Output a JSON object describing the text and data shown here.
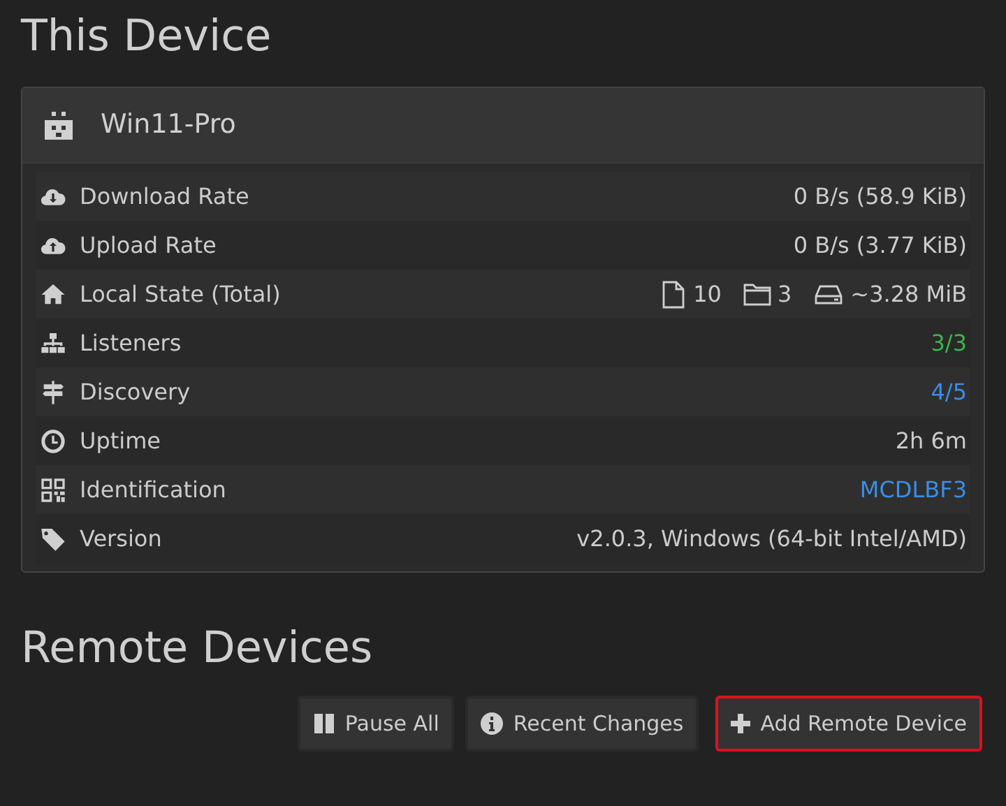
{
  "this_device": {
    "heading": "This Device",
    "device": {
      "name": "Win11-Pro"
    },
    "rows": [
      {
        "kind": "text",
        "label": "Download Rate",
        "value": "0 B/s (58.9 KiB)"
      },
      {
        "kind": "text",
        "label": "Upload Rate",
        "value": "0 B/s (3.77 KiB)"
      },
      {
        "kind": "local_state",
        "label": "Local State (Total)",
        "files": "10",
        "folders": "3",
        "size": "~3.28 MiB"
      },
      {
        "kind": "colored",
        "label": "Listeners",
        "value": "3/3",
        "color": "#3cb54a"
      },
      {
        "kind": "colored",
        "label": "Discovery",
        "value": "4/5",
        "color": "#3a8ee6"
      },
      {
        "kind": "text",
        "label": "Uptime",
        "value": "2h 6m"
      },
      {
        "kind": "colored",
        "label": "Identification",
        "value": "MCDLBF3",
        "color": "#3a8ee6"
      },
      {
        "kind": "text",
        "label": "Version",
        "value": "v2.0.3, Windows (64-bit Intel/AMD)"
      }
    ]
  },
  "remote_devices": {
    "heading": "Remote Devices",
    "buttons": [
      {
        "label": "Pause All",
        "highlighted": false
      },
      {
        "label": "Recent Changes",
        "highlighted": false
      },
      {
        "label": "Add Remote Device",
        "highlighted": true
      }
    ]
  }
}
